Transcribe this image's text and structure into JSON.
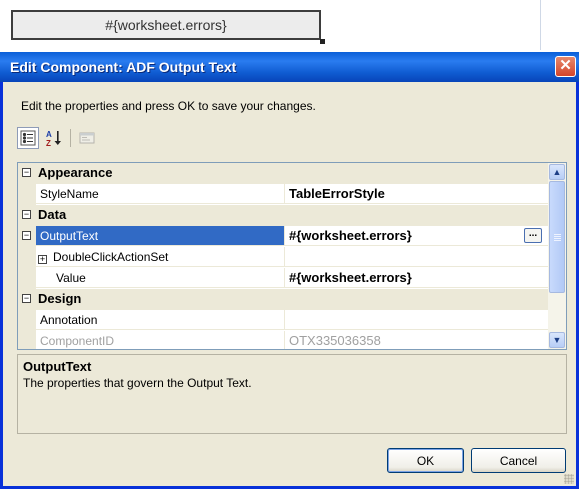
{
  "background_editor": {
    "cell_text": "#{worksheet.errors}"
  },
  "dialog": {
    "title": "Edit Component: ADF Output Text",
    "close_glyph": "✕",
    "instructions": "Edit the properties and press OK to save your changes.",
    "toolbar": {
      "categorized_icon": "categorized-icon",
      "alphabetical_icon": "sort-alphabetical-icon",
      "property_pages_icon": "property-pages-icon"
    },
    "property_grid": {
      "categories": [
        {
          "name": "Appearance",
          "expanded_glyph": "⊟",
          "properties": [
            {
              "name": "StyleName",
              "value": "TableErrorStyle"
            }
          ]
        },
        {
          "name": "Data",
          "expanded_glyph": "⊟",
          "properties": [
            {
              "name": "OutputText",
              "value": "#{worksheet.errors}",
              "selected": true,
              "expanded_glyph": "⊟",
              "has_ellipsis": true,
              "ellipsis_label": "..."
            },
            {
              "name": "DoubleClickActionSet",
              "value": "",
              "collapsed_glyph": "⊞"
            },
            {
              "name": "Value",
              "value": "#{worksheet.errors}"
            }
          ]
        },
        {
          "name": "Design",
          "expanded_glyph": "⊟",
          "properties": [
            {
              "name": "Annotation",
              "value": ""
            },
            {
              "name": "ComponentID",
              "value": "OTX335036358",
              "disabled": true
            }
          ]
        }
      ]
    },
    "description": {
      "title": "OutputText",
      "text": "The properties that govern the Output Text."
    },
    "buttons": {
      "ok": "OK",
      "cancel": "Cancel"
    }
  }
}
